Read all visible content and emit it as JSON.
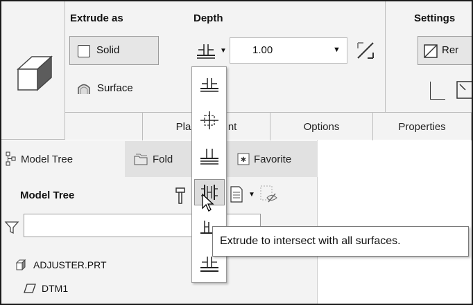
{
  "ribbon": {
    "extrude_as": {
      "title": "Extrude as",
      "solid_label": "Solid",
      "surface_label": "Surface"
    },
    "depth": {
      "title": "Depth",
      "value": "1.00"
    },
    "settings": {
      "title": "Settings",
      "remove_label": "Rer"
    }
  },
  "tabs": [
    "Plac",
    "nt",
    "Options",
    "Properties"
  ],
  "panel_tabs": {
    "model_tree": "Model Tree",
    "folder": "Fold",
    "favorites": "Favorite"
  },
  "model_tree": {
    "title": "Model Tree",
    "search_value": "",
    "items": [
      {
        "label": "ADJUSTER.PRT",
        "icon": "part-icon"
      },
      {
        "label": "DTM1",
        "icon": "datum-plane-icon"
      }
    ]
  },
  "depth_menu": {
    "items": [
      "blind-depth",
      "symmetric-depth",
      "to-next-surface",
      "through-all",
      "through-until",
      "to-selected"
    ],
    "selected_index": 3
  },
  "tooltip": {
    "text": "Extrude to intersect with all surfaces."
  }
}
